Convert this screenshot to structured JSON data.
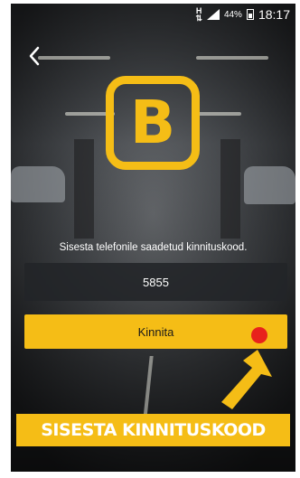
{
  "status_bar": {
    "network_type": "H",
    "battery_percent": "44%",
    "time": "18:17"
  },
  "header": {
    "back_icon": "chevron-left-icon"
  },
  "logo": {
    "letter": "B",
    "color": "#f5bd16"
  },
  "verification": {
    "instruction": "Sisesta telefonile saadetud kinnituskood.",
    "code_value": "5855",
    "confirm_label": "Kinnita"
  },
  "annotation": {
    "text": "SISESTA KINNITUSKOOD",
    "tap_marker_color": "#e8221c",
    "arrow_icon": "arrow-up-right-icon"
  }
}
